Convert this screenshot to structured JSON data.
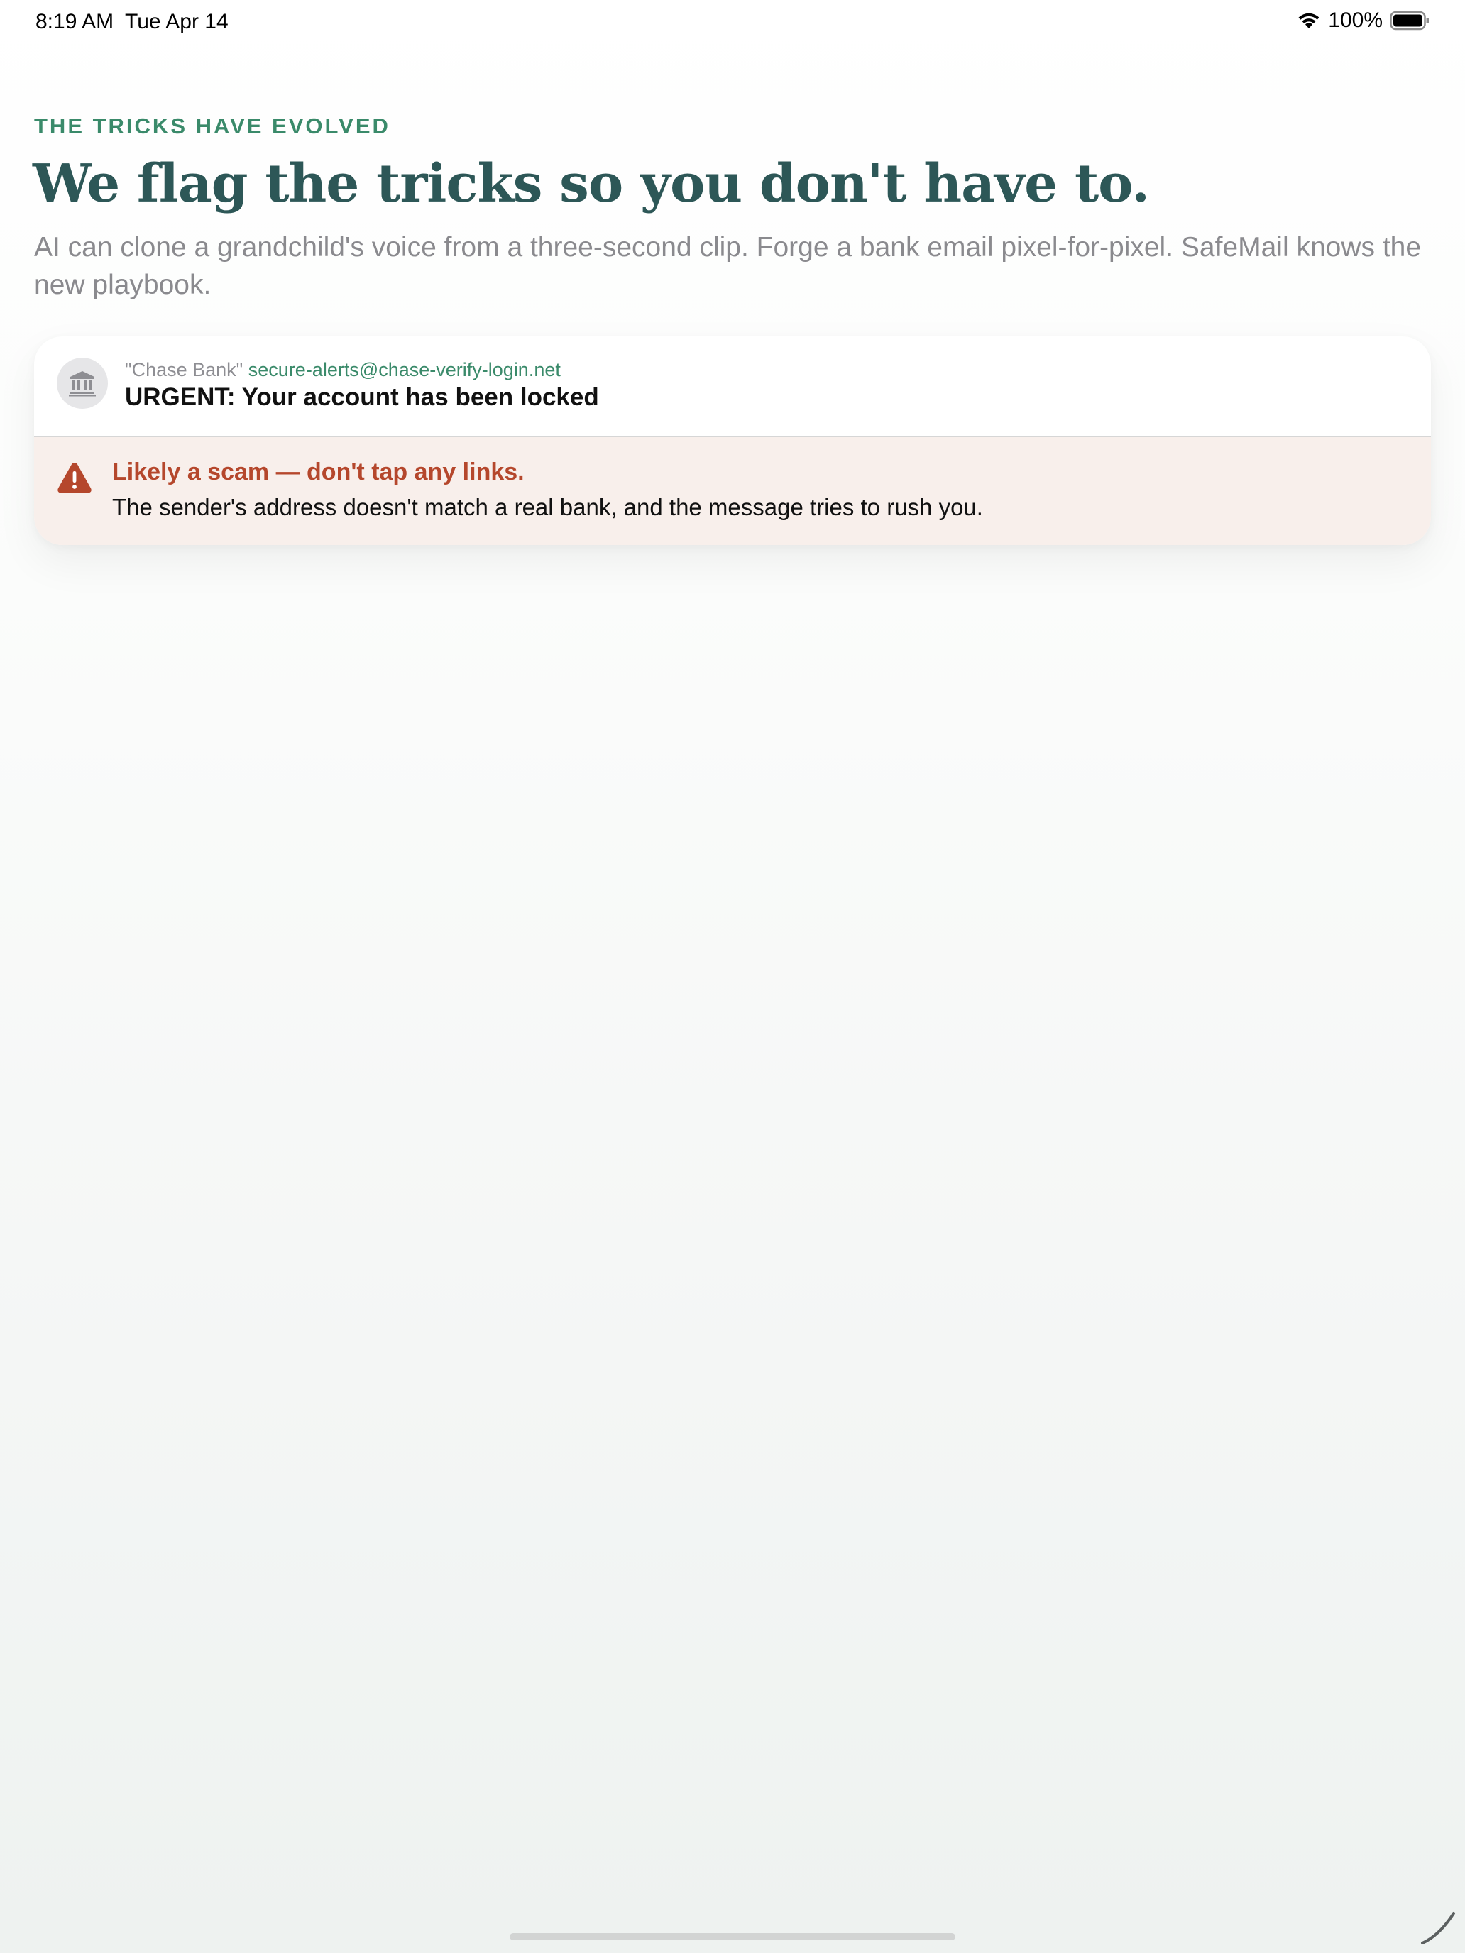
{
  "status_bar": {
    "time": "8:19 AM",
    "date": "Tue Apr 14",
    "battery": "100%"
  },
  "hero": {
    "eyebrow": "THE TRICKS HAVE EVOLVED",
    "headline": "We flag the tricks so you don't have to.",
    "subtext": "AI can clone a grandchild's voice from a three-second clip. Forge a bank email pixel-for-pixel. SafeMail knows the new playbook."
  },
  "email": {
    "avatar_icon": "bank-icon",
    "sender_name": "\"Chase Bank\"",
    "sender_email": "secure-alerts@chase-verify-login.net",
    "subject": "URGENT: Your account has been locked"
  },
  "warning": {
    "icon": "warning-triangle-icon",
    "title": "Likely a scam — don't tap any links.",
    "body": "The sender's address doesn't match a real bank, and the message tries to rush you."
  },
  "colors": {
    "accent_green": "#3a8a6a",
    "headline": "#2d5757",
    "warning_red": "#b5472c",
    "warning_bg": "#f8efeb"
  }
}
